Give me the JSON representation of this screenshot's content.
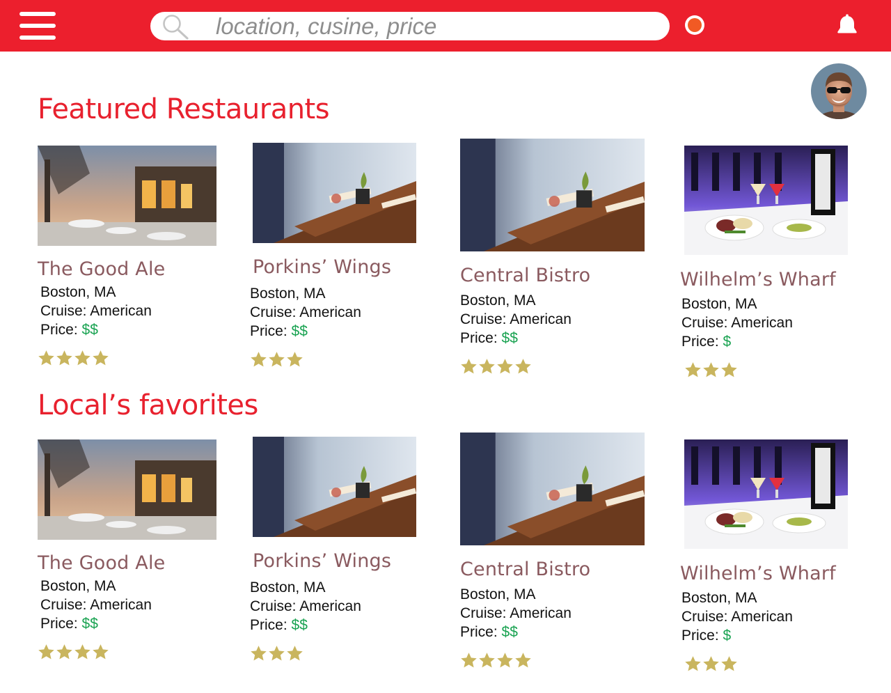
{
  "header": {
    "menu_icon": "hamburger-menu-icon",
    "search": {
      "icon": "search-icon",
      "placeholder": "location, cusine, price",
      "value": ""
    },
    "record_icon": "record-icon",
    "notification_icon": "bell-icon",
    "accent_color": "#ec1f2d"
  },
  "profile": {
    "avatar_icon": "user-avatar"
  },
  "sections": [
    {
      "title": "Featured Restaurants",
      "cards": [
        {
          "name": "The Good Ale",
          "location": "Boston, MA",
          "cuisine_label": "Cruise: American",
          "price_label": "Price: ",
          "price": "$$",
          "rating": 4,
          "photo": "patio-photo"
        },
        {
          "name": "Porkins’ Wings",
          "location": "Boston, MA",
          "cuisine_label": "Cruise: American",
          "price_label": "Price: ",
          "price": "$$",
          "rating": 3,
          "photo": "dining-tables-photo"
        },
        {
          "name": "Central Bistro",
          "location": "Boston, MA",
          "cuisine_label": "Cruise: American",
          "price_label": "Price: ",
          "price": "$$",
          "rating": 4,
          "photo": "dining-tables-photo"
        },
        {
          "name": "Wilhelm’s Wharf",
          "location": "Boston, MA",
          "cuisine_label": "Cruise: American",
          "price_label": "Price: ",
          "price": "$",
          "rating": 3,
          "photo": "plated-dinner-photo"
        }
      ]
    },
    {
      "title": "Local’s favorites",
      "cards": [
        {
          "name": "The Good Ale",
          "location": "Boston, MA",
          "cuisine_label": "Cruise: American",
          "price_label": "Price: ",
          "price": "$$",
          "rating": 4,
          "photo": "patio-photo"
        },
        {
          "name": "Porkins’ Wings",
          "location": "Boston, MA",
          "cuisine_label": "Cruise: American",
          "price_label": "Price: ",
          "price": "$$",
          "rating": 3,
          "photo": "dining-tables-photo"
        },
        {
          "name": "Central Bistro",
          "location": "Boston, MA",
          "cuisine_label": "Cruise: American",
          "price_label": "Price: ",
          "price": "$$",
          "rating": 4,
          "photo": "dining-tables-photo"
        },
        {
          "name": "Wilhelm’s Wharf",
          "location": "Boston, MA",
          "cuisine_label": "Cruise: American",
          "price_label": "Price: ",
          "price": "$",
          "rating": 3,
          "photo": "plated-dinner-photo"
        }
      ]
    }
  ],
  "colors": {
    "title": "#e8212e",
    "name": "#8a5a5f",
    "price": "#1aa352",
    "star": "#c9b55e"
  }
}
